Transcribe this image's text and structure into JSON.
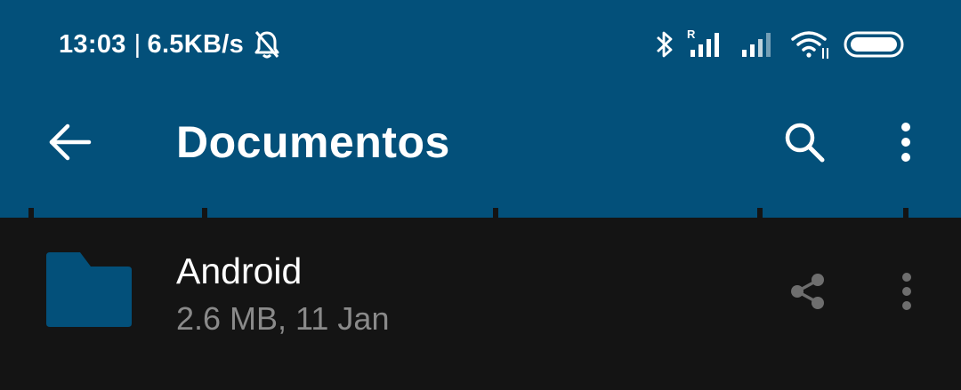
{
  "colors": {
    "header_bg": "#03507a",
    "page_bg": "#141414",
    "folder": "#03507a",
    "secondary_text": "#8a8a8a"
  },
  "status_bar": {
    "time": "13:03",
    "separator": "|",
    "net_speed": "6.5KB/s",
    "icons": [
      "bell-off-icon",
      "bluetooth-icon",
      "signal-roaming-icon",
      "signal-icon",
      "wifi-icon",
      "battery-icon"
    ],
    "roaming_label": "R"
  },
  "toolbar": {
    "title": "Documentos",
    "back_icon": "arrow-back-icon",
    "search_icon": "search-icon",
    "more_icon": "more-vert-icon"
  },
  "files": [
    {
      "name": "Android",
      "meta": "2.6 MB, 11 Jan",
      "icon": "folder-icon"
    }
  ]
}
